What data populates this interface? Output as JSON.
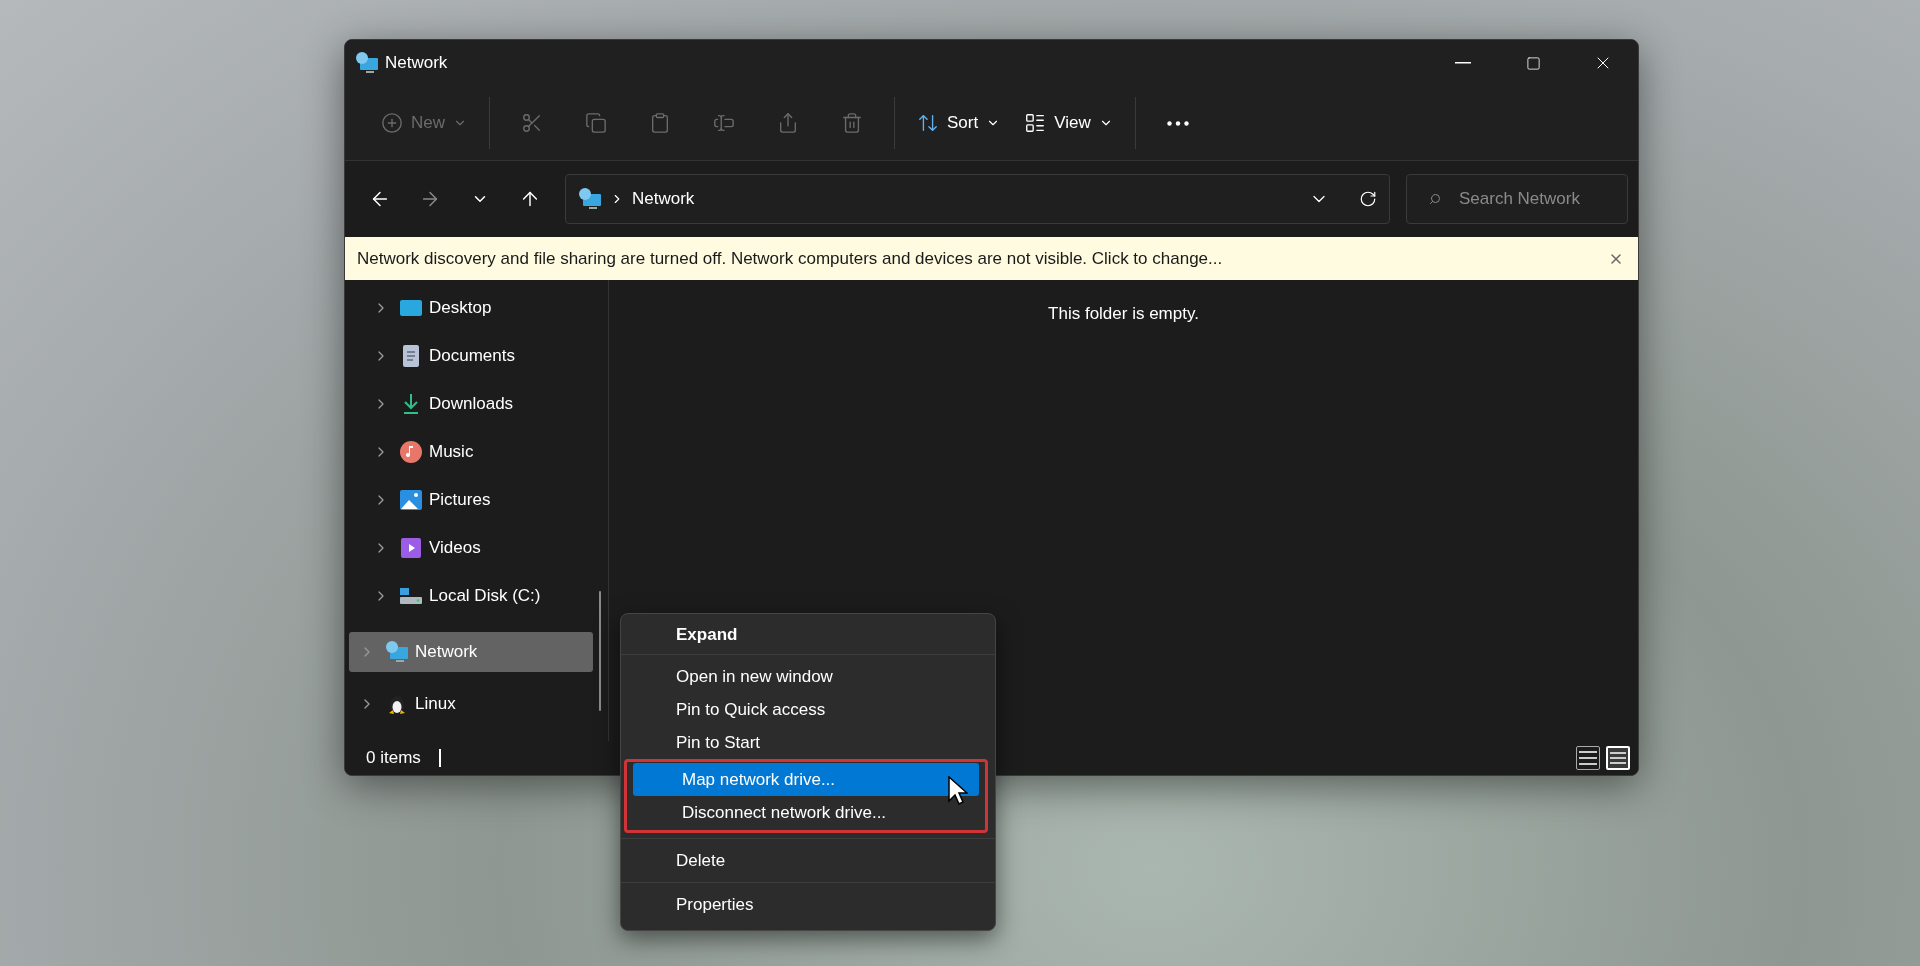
{
  "window": {
    "title": "Network"
  },
  "toolbar": [
    {
      "kind": "text",
      "label": "New",
      "disabled": true,
      "dropdown": true
    },
    {
      "kind": "separator"
    },
    {
      "kind": "icon",
      "disabled": true
    },
    {
      "kind": "icon",
      "disabled": true
    },
    {
      "kind": "icon",
      "disabled": true
    },
    {
      "kind": "icon",
      "disabled": true
    },
    {
      "kind": "icon",
      "disabled": true
    },
    {
      "kind": "icon",
      "disabled": true
    },
    {
      "kind": "separator"
    },
    {
      "kind": "text",
      "label": "Sort",
      "disabled": false,
      "dropdown": true
    },
    {
      "kind": "text",
      "label": "View",
      "disabled": false,
      "dropdown": true
    },
    {
      "kind": "separator"
    },
    {
      "kind": "icon",
      "disabled": false
    }
  ],
  "navigation": {
    "back_disabled": false,
    "forward_disabled": true,
    "up_disabled": false
  },
  "address_bar": {
    "crumbs": [
      "Network"
    ]
  },
  "search": {
    "placeholder": "Search Network"
  },
  "banner": {
    "text": "Network discovery and file sharing are turned off. Network computers and devices are not visible. Click to change..."
  },
  "sidebar": {
    "sections": [
      {
        "items": [
          {
            "label": "Desktop",
            "selected": false
          },
          {
            "label": "Documents",
            "selected": false
          },
          {
            "label": "Downloads",
            "selected": false
          },
          {
            "label": "Music",
            "selected": false
          },
          {
            "label": "Pictures",
            "selected": false
          },
          {
            "label": "Videos",
            "selected": false
          },
          {
            "label": "Local Disk (C:)",
            "selected": false
          }
        ]
      },
      {
        "items": [
          {
            "label": "Network",
            "selected": true
          }
        ]
      },
      {
        "items": [
          {
            "label": "Linux",
            "selected": false
          }
        ]
      }
    ]
  },
  "content": {
    "empty_message": "This folder is empty."
  },
  "status_bar": {
    "item_count": "0 items",
    "views": [
      {
        "selected": false
      },
      {
        "selected": true
      }
    ]
  },
  "context_menu": {
    "groups": [
      {
        "items": [
          {
            "label": "Expand",
            "bold": true,
            "selected": false,
            "annotated": false
          }
        ]
      },
      {
        "items": [
          {
            "label": "Open in new window",
            "bold": false,
            "selected": false,
            "annotated": false
          },
          {
            "label": "Pin to Quick access",
            "bold": false,
            "selected": false,
            "annotated": false
          },
          {
            "label": "Pin to Start",
            "bold": false,
            "selected": false,
            "annotated": false
          },
          {
            "label": "Map network drive...",
            "bold": false,
            "selected": true,
            "annotated": true
          },
          {
            "label": "Disconnect network drive...",
            "bold": false,
            "selected": false,
            "annotated": true
          }
        ]
      },
      {
        "items": [
          {
            "label": "Delete",
            "bold": false,
            "selected": false,
            "annotated": false
          }
        ]
      },
      {
        "items": [
          {
            "label": "Properties",
            "bold": false,
            "selected": false,
            "annotated": false
          }
        ]
      }
    ]
  }
}
